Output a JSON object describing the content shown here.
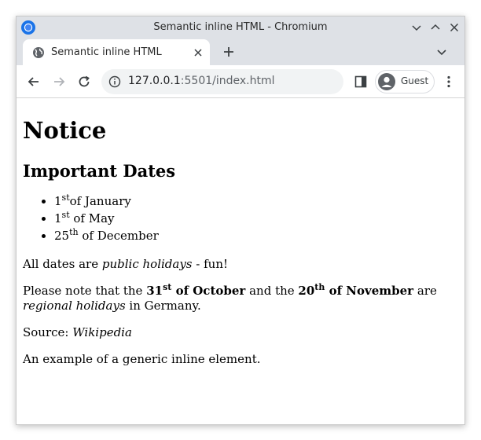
{
  "window": {
    "title": "Semantic inline HTML - Chromium"
  },
  "tab": {
    "title": "Semantic inline HTML"
  },
  "toolbar": {
    "url_host": "127.0.0.1",
    "url_rest": ":5501/index.html",
    "profile_label": "Guest"
  },
  "icons": {
    "app": "chromium-icon",
    "minimize": "chevron-down-icon",
    "maximize": "chevron-up-icon",
    "close": "close-icon",
    "tab_favicon": "globe-icon",
    "tab_close": "close-icon",
    "new_tab": "plus-icon",
    "tab_list": "chevron-down-icon",
    "back": "back-arrow-icon",
    "forward": "forward-arrow-icon",
    "reload": "reload-icon",
    "site_info": "info-icon",
    "side_panel": "side-panel-icon",
    "avatar": "person-icon",
    "menu": "kebab-menu-icon"
  },
  "page": {
    "heading": "Notice",
    "subheading": "Important Dates",
    "dates": [
      {
        "num": "1",
        "suffix": "st",
        "rest": "of January"
      },
      {
        "num": "1",
        "suffix": "st",
        "rest": " of May"
      },
      {
        "num": "25",
        "suffix": "th",
        "rest": " of December"
      }
    ],
    "holidays_para": {
      "before": "All dates are ",
      "emph": "public holidays",
      "after": " - fun!"
    },
    "regional_para": {
      "t1": "Please note that the ",
      "d1_num": "31",
      "d1_suffix": "st",
      "d1_rest": " of October",
      "t2": " and the ",
      "d2_num": "20",
      "d2_suffix": "th",
      "d2_rest": " of November",
      "t3": " are ",
      "emph": "regional holidays",
      "t4": " in Germany."
    },
    "source_para": {
      "label": "Source: ",
      "cite": "Wikipedia"
    },
    "generic_para": "An example of a generic inline element."
  },
  "colors": {
    "chrome_frame": "#dee1e6",
    "omnibox_bg": "#f1f3f4",
    "icon_gray": "#5f6368",
    "chromium_blue": "#1a73e8"
  }
}
